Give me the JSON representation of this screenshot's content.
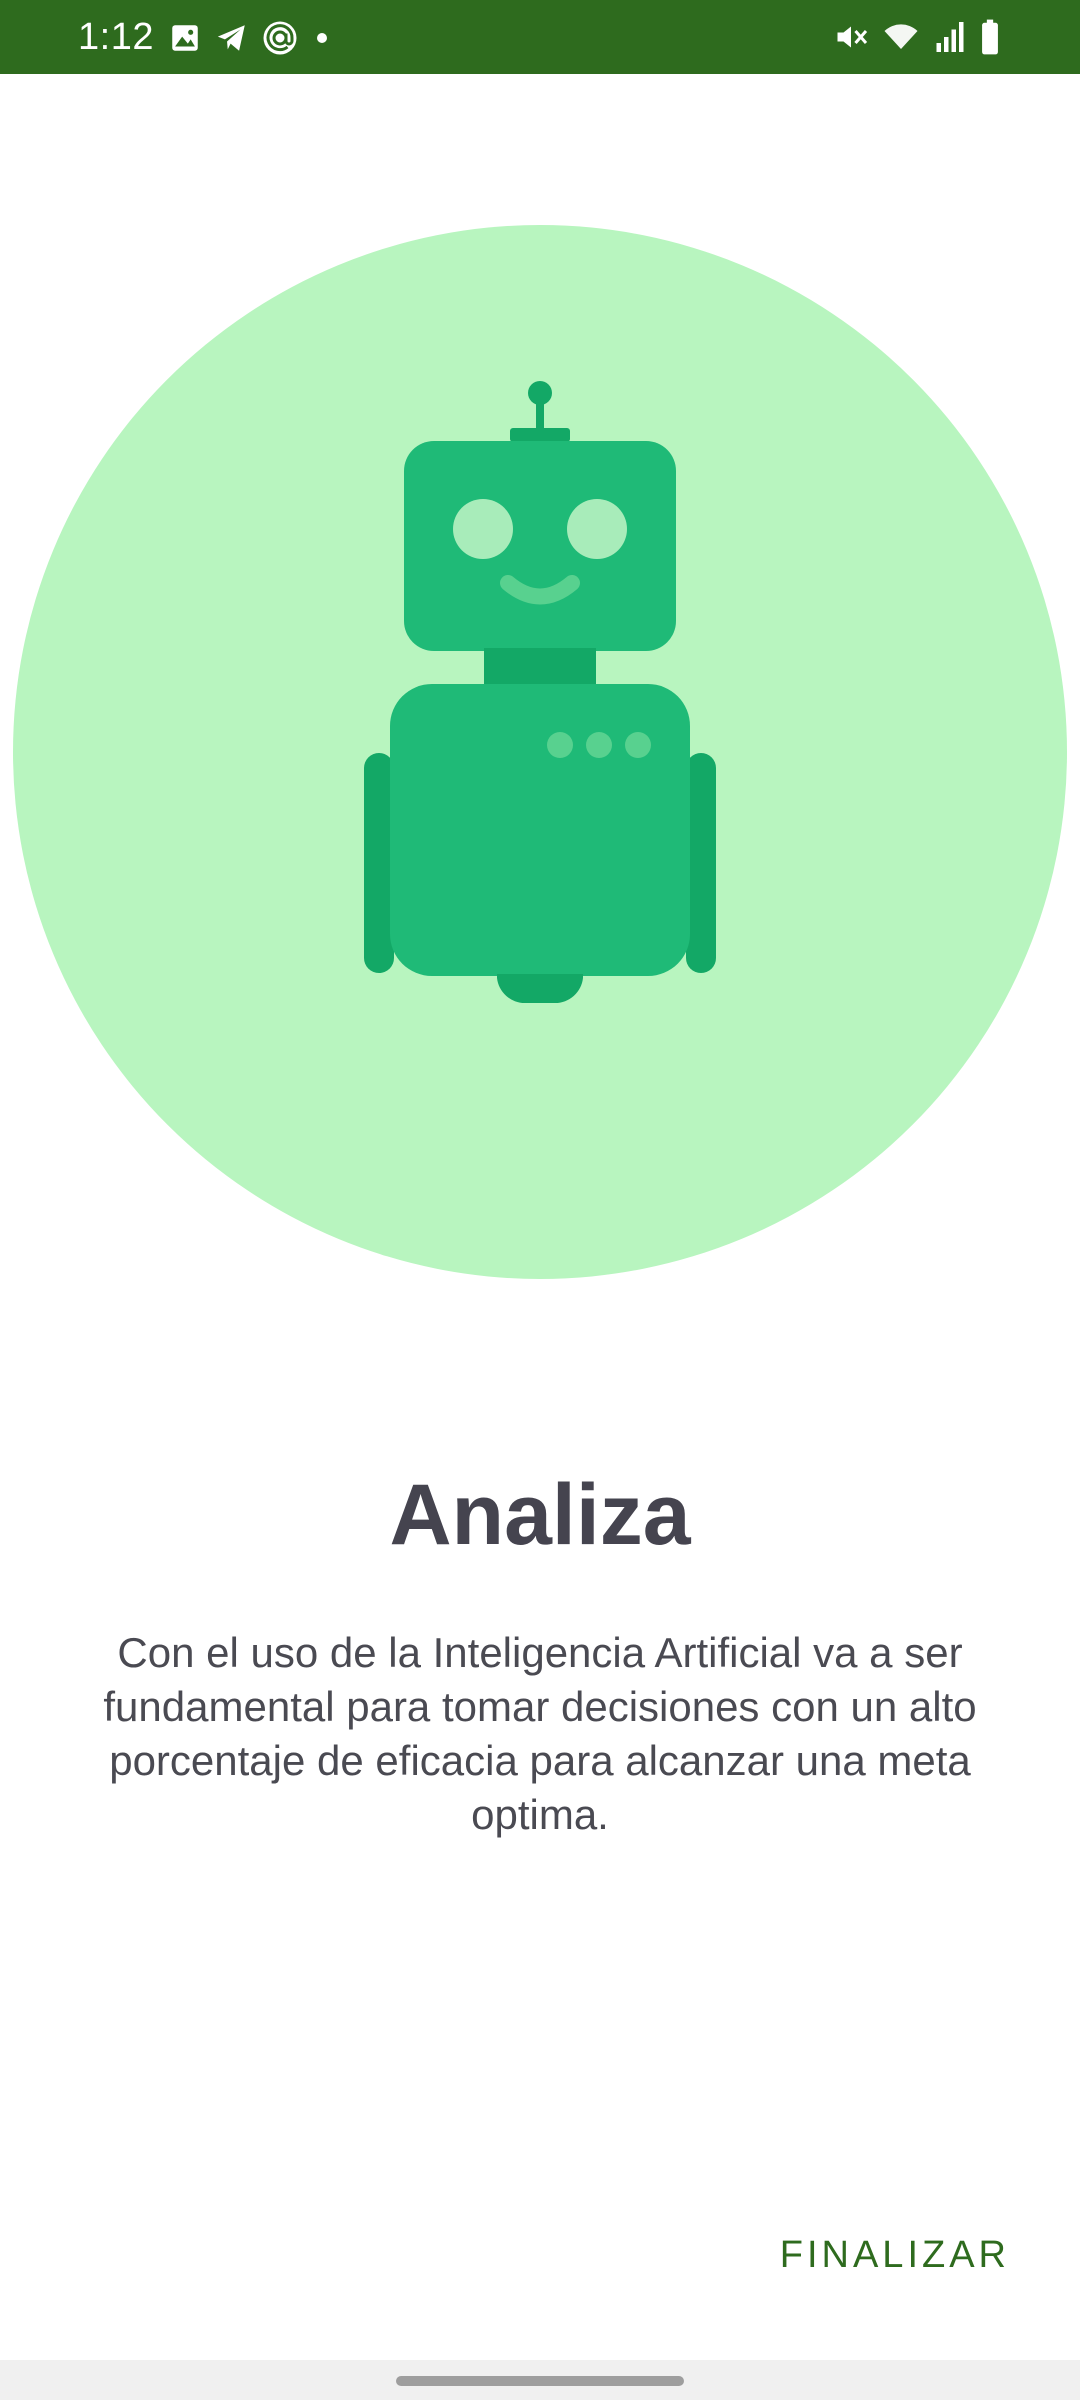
{
  "status_bar": {
    "time": "1:12",
    "background_color": "#2e6b1e",
    "left_icons": [
      "image-icon",
      "telegram-icon",
      "at-sign-icon",
      "dot-icon"
    ],
    "right_icons": [
      "vibrate-mute-icon",
      "wifi-icon",
      "signal-icon",
      "battery-icon"
    ]
  },
  "illustration": {
    "name": "robot-illustration",
    "circle_color": "#b8f5bf",
    "robot_color": "#1fba77",
    "robot_dark_color": "#13a866"
  },
  "content": {
    "title": "Analiza",
    "description": "Con el uso de la Inteligencia Artificial va a ser fundamental para tomar decisiones con un alto porcentaje de eficacia para alcanzar una meta optima."
  },
  "actions": {
    "finish_label": "FINALIZAR",
    "accent_color": "#2e6b1e"
  }
}
